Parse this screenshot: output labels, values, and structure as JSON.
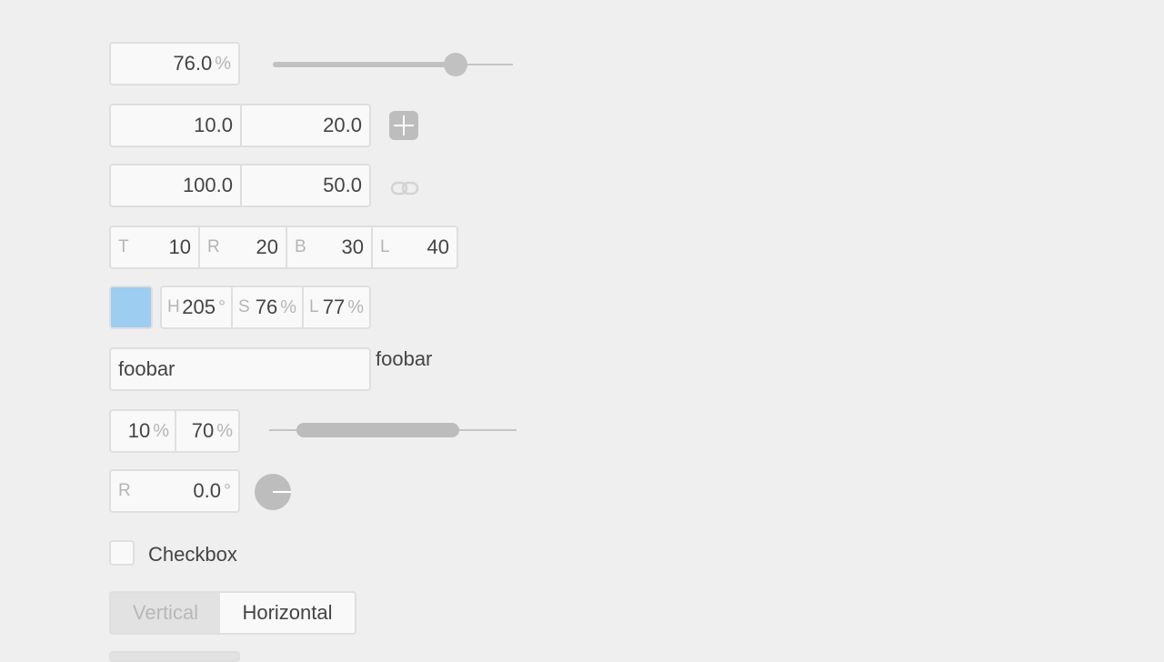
{
  "opacity": {
    "value": "76.0",
    "unit": "%",
    "fraction": 0.76
  },
  "position": {
    "x": "10.0",
    "y": "20.0"
  },
  "size": {
    "width": "100.0",
    "height": "50.0"
  },
  "padding": [
    {
      "prefix": "T",
      "value": "10"
    },
    {
      "prefix": "R",
      "value": "20"
    },
    {
      "prefix": "B",
      "value": "30"
    },
    {
      "prefix": "L",
      "value": "40"
    }
  ],
  "color": {
    "swatch": "#9dcdf0",
    "h": {
      "prefix": "H",
      "value": "205",
      "unit": "°"
    },
    "s": {
      "prefix": "S",
      "value": "76",
      "unit": "%"
    },
    "l": {
      "prefix": "L",
      "value": "77",
      "unit": "%"
    }
  },
  "text": {
    "value": "foobar",
    "mirror": "foobar"
  },
  "range": {
    "start": {
      "value": "10",
      "unit": "%"
    },
    "end": {
      "value": "70",
      "unit": "%"
    },
    "start_fraction": 0.1,
    "end_fraction": 0.7
  },
  "rotation": {
    "prefix": "R",
    "value": "0.0",
    "unit": "°"
  },
  "checkbox": {
    "label": "Checkbox",
    "checked": false
  },
  "orientation": {
    "options": [
      "Vertical",
      "Horizontal"
    ],
    "selected": "Horizontal"
  },
  "icons": {
    "add": "plus-icon",
    "link": "link-icon",
    "dial": "rotation-dial-icon"
  }
}
